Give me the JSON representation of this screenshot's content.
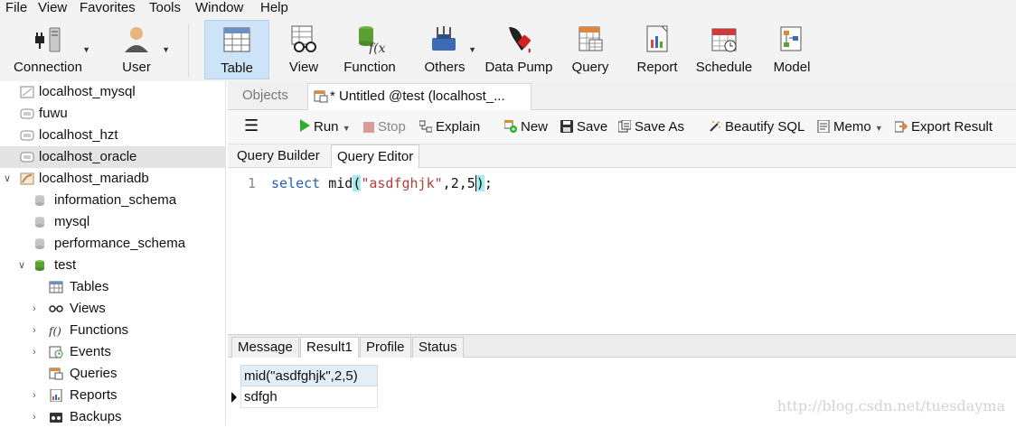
{
  "menu": [
    "File",
    "View",
    "Favorites",
    "Tools",
    "Window",
    "Help"
  ],
  "toolbar": {
    "buttons": [
      {
        "label": "Connection",
        "icon": "connection-plug-icon"
      },
      {
        "label": "User",
        "icon": "user-icon"
      },
      {
        "label": "Table",
        "icon": "table-icon"
      },
      {
        "label": "View",
        "icon": "view-glasses-icon"
      },
      {
        "label": "Function",
        "icon": "function-icon"
      },
      {
        "label": "Others",
        "icon": "others-tools-icon"
      },
      {
        "label": "Data Pump",
        "icon": "data-pump-icon"
      },
      {
        "label": "Query",
        "icon": "query-icon"
      },
      {
        "label": "Report",
        "icon": "report-icon"
      },
      {
        "label": "Schedule",
        "icon": "schedule-icon"
      },
      {
        "label": "Model",
        "icon": "model-icon"
      }
    ]
  },
  "sidebar": {
    "items": [
      {
        "label": "localhost_mysql"
      },
      {
        "label": "fuwu"
      },
      {
        "label": "localhost_hzt"
      },
      {
        "label": "localhost_oracle"
      },
      {
        "label": "localhost_mariadb"
      },
      {
        "label": "information_schema"
      },
      {
        "label": "mysql"
      },
      {
        "label": "performance_schema"
      },
      {
        "label": "test"
      },
      {
        "label": "Tables"
      },
      {
        "label": "Views"
      },
      {
        "label": "Functions"
      },
      {
        "label": "Events"
      },
      {
        "label": "Queries"
      },
      {
        "label": "Reports"
      },
      {
        "label": "Backups"
      }
    ]
  },
  "tabs": {
    "objects": "Objects",
    "query": "* Untitled @test (localhost_..."
  },
  "actions": {
    "menu_icon": "hamburger-icon",
    "run": "Run",
    "stop": "Stop",
    "explain": "Explain",
    "new": "New",
    "save": "Save",
    "save_as": "Save As",
    "beautify": "Beautify SQL",
    "memo": "Memo",
    "export": "Export Result"
  },
  "subtabs": {
    "builder": "Query Builder",
    "editor": "Query Editor"
  },
  "editor": {
    "line_number": "1",
    "kw": "select",
    "fn": "mid",
    "open": "(",
    "str": "\"asdfghjk\"",
    "c1": ",",
    "n1": "2",
    "c2": ",",
    "n2": "5",
    "close": ")",
    "semi": ";"
  },
  "results": {
    "tabs": [
      "Message",
      "Result1",
      "Profile",
      "Status"
    ],
    "column": "mid(\"asdfghjk\",2,5)",
    "value": "sdfgh"
  },
  "watermark": "http://blog.csdn.net/tuesdayma",
  "colors": {
    "toolbar_bg": "#f3f3f3",
    "active_button": "#cde3f7",
    "keyword": "#2a5db0",
    "string": "#b0403c",
    "bracket_highlight": "#a6ecef",
    "run_green": "#2eae2e"
  }
}
